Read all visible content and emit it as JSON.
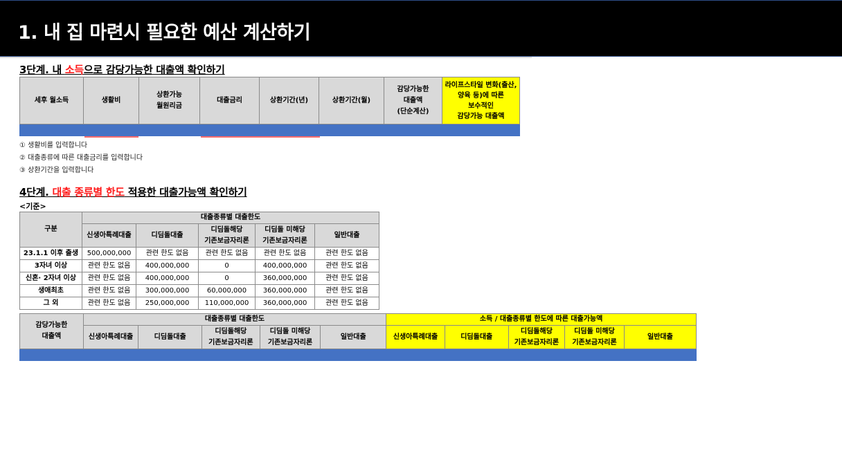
{
  "slide_title": "1. 내 집 마련시 필요한 예산 계산하기",
  "step3": {
    "prefix": "3단계. 내 ",
    "highlight": "소득",
    "suffix": "으로 감당가능한 대출액 확인하기",
    "headers": [
      "세후 월소득",
      "생활비",
      "상환가능\n월원리금",
      "대출금리",
      "상환기간(년)",
      "상환기간(월)",
      "감당가능한\n대출액\n(단순계산)",
      "라이프스타일 변화(출산, 양육 등)에 따른\n보수적인\n감당가능 대출액"
    ]
  },
  "notes": [
    "① 생활비를 입력합니다",
    "② 대출종류에 따른 대출금리를 입력합니다",
    "③ 상환기간을 입력합니다"
  ],
  "step4": {
    "prefix": "4단계. ",
    "highlight": "대출 종류별 한도",
    "suffix": " 적용한 대출가능액 확인하기",
    "standard_label": "<기준>",
    "limits_table": {
      "corner": "구분",
      "group_header": "대출종류별 대출한도",
      "columns": [
        "신생아특례대출",
        "디딤돌대출",
        "디딤돌해당\n기존보금자리론",
        "디딤돌 미해당\n기존보금자리론",
        "일반대출"
      ],
      "rows": [
        {
          "label": "23.1.1 이후 출생",
          "cells": [
            "500,000,000",
            "관련 한도 없음",
            "관련 한도 없음",
            "관련 한도 없음",
            "관련 한도 없음"
          ]
        },
        {
          "label": "3자녀 이상",
          "cells": [
            "관련 한도 없음",
            "400,000,000",
            "0",
            "400,000,000",
            "관련 한도 없음"
          ]
        },
        {
          "label": "신혼· 2자녀 이상",
          "cells": [
            "관련 한도 없음",
            "400,000,000",
            "0",
            "360,000,000",
            "관련 한도 없음"
          ]
        },
        {
          "label": "생애최초",
          "cells": [
            "관련 한도 없음",
            "300,000,000",
            "60,000,000",
            "360,000,000",
            "관련 한도 없음"
          ]
        },
        {
          "label": "그 외",
          "cells": [
            "관련 한도 없음",
            "250,000,000",
            "110,000,000",
            "360,000,000",
            "관련 한도 없음"
          ]
        }
      ]
    },
    "result_table": {
      "corner": "감당가능한\n대출액",
      "group_header_left": "대출종류별 대출한도",
      "group_header_right": "소득 / 대출종류별 한도에 따른 대출가능액",
      "columns_left": [
        "신생아특례대출",
        "디딤돌대출",
        "디딤돌해당\n기존보금자리론",
        "디딤돌 미해당\n기존보금자리론",
        "일반대출"
      ],
      "columns_right": [
        "신생아특례대출",
        "디딤돌대출",
        "디딤돌해당\n기존보금자리론",
        "디딤돌 미해당\n기존보금자리론",
        "일반대출"
      ]
    }
  },
  "colors": {
    "title_bg": "#000000",
    "highlight_red": "#ff1a1a",
    "header_gray": "#d9d9d9",
    "yellow": "#ffff00",
    "blue_bar": "#4472c4"
  }
}
